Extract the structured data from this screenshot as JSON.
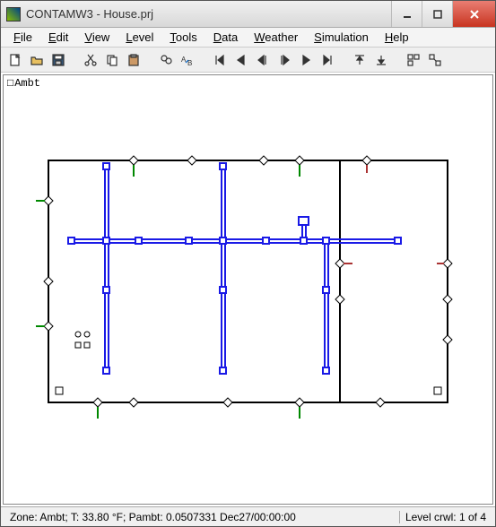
{
  "window": {
    "title": "CONTAMW3 - House.prj"
  },
  "menu": {
    "items": [
      "File",
      "Edit",
      "View",
      "Level",
      "Tools",
      "Data",
      "Weather",
      "Simulation",
      "Help"
    ]
  },
  "toolbar": {
    "icons": [
      "new-file-icon",
      "open-file-icon",
      "save-icon",
      "sep",
      "cut-icon",
      "copy-icon",
      "paste-icon",
      "sep",
      "find-icon",
      "find-replace-icon",
      "sep",
      "first-icon",
      "prev-icon",
      "prev-step-icon",
      "next-step-icon",
      "next-icon",
      "last-icon",
      "sep",
      "level-up-icon",
      "level-down-icon",
      "sep",
      "toggle-grid-icon",
      "toggle-snap-icon"
    ]
  },
  "canvas": {
    "ambt_label": "Ambt"
  },
  "status": {
    "left": "Zone: Ambt; T: 33.80 °F; Pambt: 0.0507331 Dec27/00:00:00",
    "right": "Level crwl: 1 of 4"
  },
  "colors": {
    "wall": "#000000",
    "duct": "#1a1ae6",
    "path_green": "#008800",
    "path_red": "#aa3333"
  }
}
